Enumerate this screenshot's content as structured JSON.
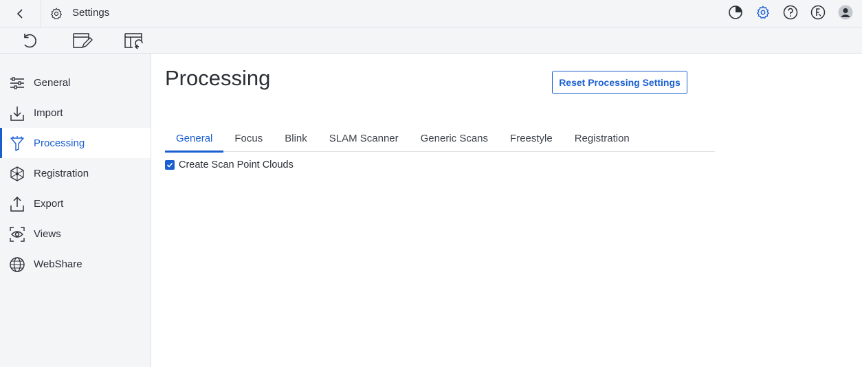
{
  "window": {
    "title": "Settings"
  },
  "titlebar": {
    "icons": [
      "progress-pie-icon",
      "gear-icon",
      "help-icon",
      "license-icon",
      "user-avatar-icon"
    ]
  },
  "toolbar": {
    "icons": [
      "undo-icon",
      "edit-settings-icon",
      "import-settings-icon"
    ]
  },
  "sidebar": {
    "items": [
      {
        "label": "General",
        "icon": "sliders-icon",
        "active": false
      },
      {
        "label": "Import",
        "icon": "import-icon",
        "active": false
      },
      {
        "label": "Processing",
        "icon": "processing-icon",
        "active": true
      },
      {
        "label": "Registration",
        "icon": "registration-icon",
        "active": false
      },
      {
        "label": "Export",
        "icon": "export-icon",
        "active": false
      },
      {
        "label": "Views",
        "icon": "views-icon",
        "active": false
      },
      {
        "label": "WebShare",
        "icon": "globe-icon",
        "active": false
      }
    ]
  },
  "main": {
    "title": "Processing",
    "reset_button": "Reset Processing Settings",
    "tabs": [
      {
        "label": "General",
        "active": true
      },
      {
        "label": "Focus",
        "active": false
      },
      {
        "label": "Blink",
        "active": false
      },
      {
        "label": "SLAM Scanner",
        "active": false
      },
      {
        "label": "Generic Scans",
        "active": false
      },
      {
        "label": "Freestyle",
        "active": false
      },
      {
        "label": "Registration",
        "active": false
      }
    ],
    "options": [
      {
        "label": "Create Scan Point Clouds",
        "checked": true
      }
    ]
  },
  "colors": {
    "accent": "#1a5fd0",
    "sidebar_bg": "#f4f5f7",
    "text": "#2b2f36"
  }
}
